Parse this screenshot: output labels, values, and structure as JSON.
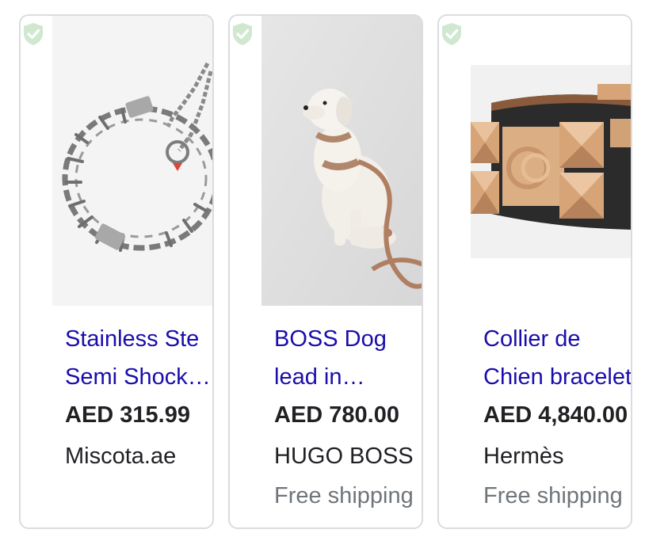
{
  "products": [
    {
      "title_line1": "Stainless Ste",
      "title_line2": "Semi Shock…",
      "price": "AED 315.99",
      "merchant": "Miscota.ae",
      "shipping": "",
      "image_icon": "prong-collar-image",
      "badge_icon": "verified-shield-icon"
    },
    {
      "title_line1": "BOSS Dog",
      "title_line2": "lead in…",
      "price": "AED 780.00",
      "merchant": "HUGO BOSS",
      "shipping": "Free shipping",
      "image_icon": "dog-on-leash-image",
      "badge_icon": "verified-shield-icon"
    },
    {
      "title_line1": "Collier de",
      "title_line2": "Chien bracelet",
      "price": "AED 4,840.00",
      "merchant": "Hermès",
      "shipping": "Free shipping",
      "image_icon": "leather-cuff-bracelet-image",
      "badge_icon": "verified-shield-icon"
    }
  ],
  "colors": {
    "title_link": "#1a0dab",
    "price": "#202124",
    "shipping": "#70757a",
    "card_border": "#dadce0",
    "badge": "#c8e6c9"
  }
}
